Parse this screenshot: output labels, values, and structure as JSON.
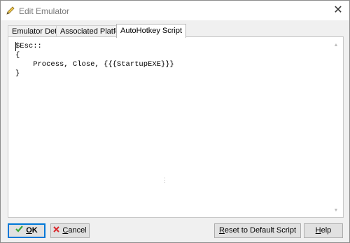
{
  "window": {
    "title": "Edit Emulator"
  },
  "tabs": [
    {
      "label": "Emulator Details"
    },
    {
      "label": "Associated Platforms"
    },
    {
      "label": "AutoHotkey Script"
    }
  ],
  "editor": {
    "content": "$Esc::\n{\n    Process, Close, {{{StartupEXE}}}\n}"
  },
  "buttons": {
    "ok": {
      "label_underline": "O",
      "label_rest": "K"
    },
    "cancel": {
      "label_underline": "C",
      "label_rest": "ancel"
    },
    "reset": {
      "label_underline": "R",
      "label_rest": "eset to Default Script"
    },
    "help": {
      "label_underline": "H",
      "label_rest": "elp"
    }
  },
  "icons": {
    "title": "pencil-icon",
    "ok": "check-icon",
    "cancel": "x-icon"
  },
  "colors": {
    "default_button_border": "#0078d7",
    "ok_check": "#3aa63a",
    "cancel_x": "#d9262b"
  }
}
